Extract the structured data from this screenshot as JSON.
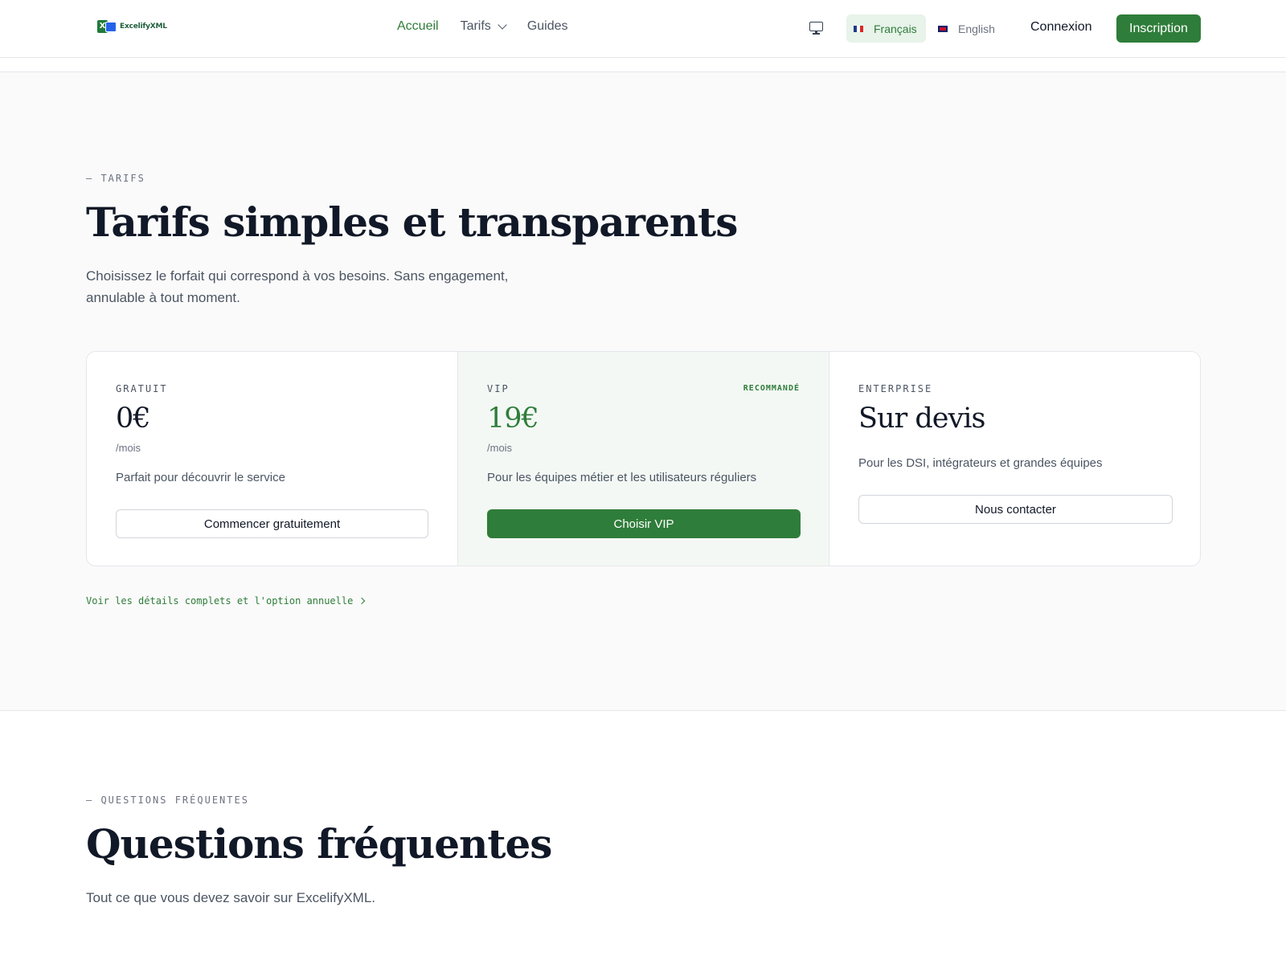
{
  "header": {
    "logo_text": "ExcelifyXML",
    "logo_mark_letter": "X",
    "nav": [
      {
        "label": "Accueil",
        "active": true
      },
      {
        "label": "Tarifs",
        "has_dropdown": true
      },
      {
        "label": "Guides"
      }
    ],
    "display_toggle_icon": "monitor-icon",
    "languages": [
      {
        "label": "Français",
        "flag": "fr",
        "selected": true
      },
      {
        "label": "English",
        "flag": "gb",
        "selected": false
      }
    ],
    "login_label": "Connexion",
    "signup_label": "Inscription"
  },
  "pricing": {
    "eyebrow": "— TARIFS",
    "title": "Tarifs simples et transparents",
    "lead_line1": "Choisissez le forfait qui correspond à vos besoins. Sans engagement,",
    "lead_line2": "annulable à tout moment.",
    "plans": [
      {
        "name": "GRATUIT",
        "price": "0€",
        "period": "/mois",
        "description": "Parfait pour découvrir le service",
        "cta": "Commencer gratuitement"
      },
      {
        "name": "VIP",
        "badge": "RECOMMANDÉ",
        "price": "19€",
        "period": "/mois",
        "description": "Pour les équipes métier et les utilisateurs réguliers",
        "cta": "Choisir VIP"
      },
      {
        "name": "ENTERPRISE",
        "price": "Sur devis",
        "description": "Pour les DSI, intégrateurs et grandes équipes",
        "cta": "Nous contacter"
      }
    ],
    "details_link": "Voir les détails complets et l'option annuelle"
  },
  "faq": {
    "eyebrow": "— QUESTIONS FRÉQUENTES",
    "title": "Questions fréquentes",
    "lead": "Tout ce que vous devez savoir sur ExcelifyXML."
  },
  "colors": {
    "accent": "#2f7d3a",
    "accent_soft": "#e8f3ea",
    "section_bg": "#fafafa"
  }
}
